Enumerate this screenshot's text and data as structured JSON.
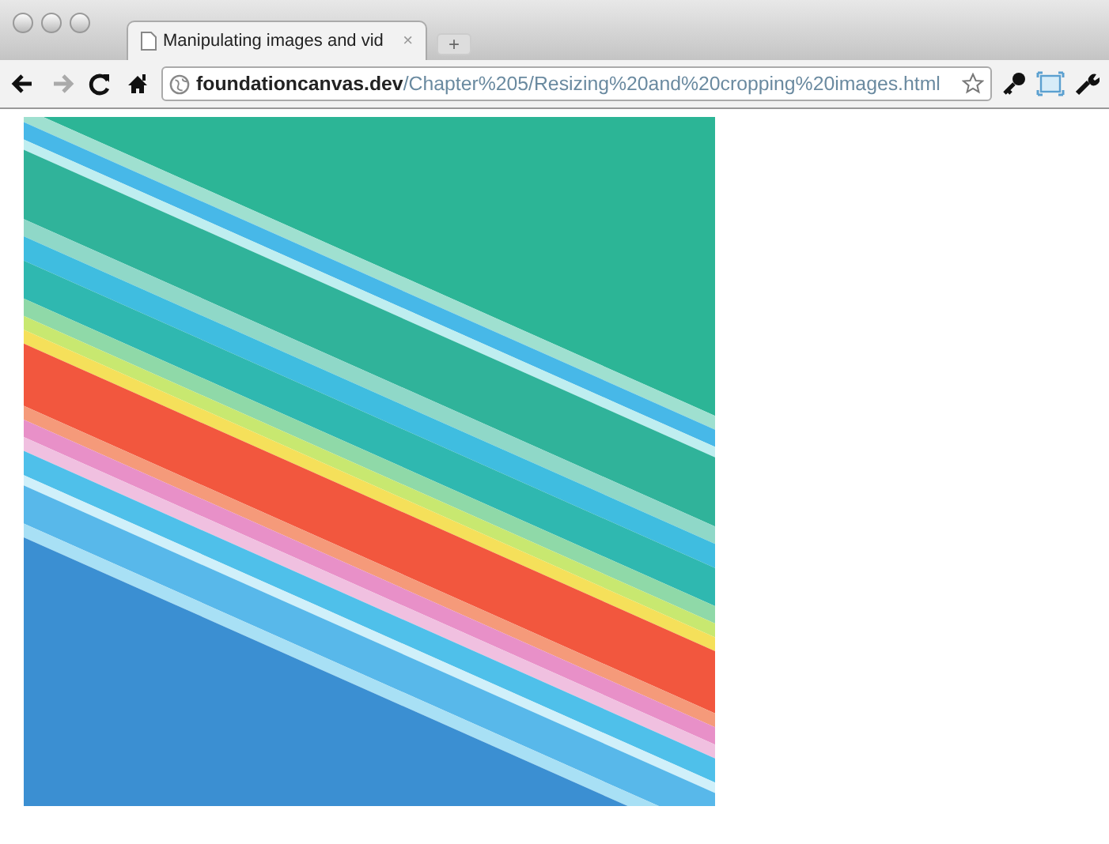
{
  "window": {
    "tab": {
      "title": "Manipulating images and vid",
      "close": "×",
      "selected": true
    },
    "new_tab": "+"
  },
  "toolbar": {
    "nav": [
      {
        "kind": "back",
        "disabled": false
      },
      {
        "kind": "forward",
        "disabled": true
      },
      {
        "kind": "reload",
        "disabled": false
      },
      {
        "kind": "home",
        "disabled": false
      }
    ],
    "address": "**foundationcanvas.dev**/Chapter%205/Resizing%20and%20cropping%20images.html",
    "tools": [
      {
        "kind": "key"
      },
      {
        "kind": "frame"
      },
      {
        "kind": "wrench"
      }
    ]
  }
}
